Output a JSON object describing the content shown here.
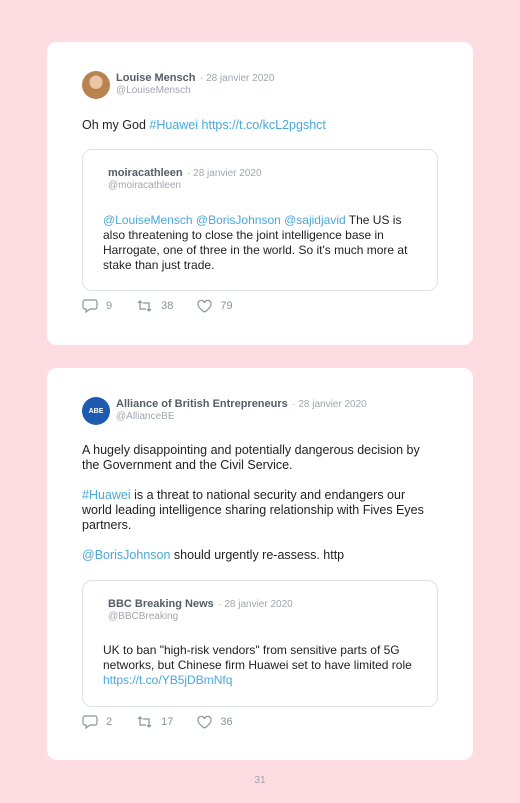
{
  "tweets": [
    {
      "author": "Louise Mensch",
      "date": "28 janvier 2020",
      "handle": "@LouiseMensch",
      "text_plain": "Oh my God ",
      "hashtag": "#Huawei",
      "link": "https://t.co/kcL2pgshct",
      "quote": {
        "author": "moiracathleen",
        "date": "28 janvier 2020",
        "handle": "@moiracathleen",
        "mentions": "@LouiseMensch @BorisJohnson @sajidjavid",
        "text": " The US is also threatening to close the joint intelligence base in Harrogate, one of three in the world. So it's much more at stake than just trade."
      },
      "replies": "9",
      "retweets": "38",
      "likes": "79"
    },
    {
      "author": "Alliance of British Entrepreneurs",
      "date": "28 janvier 2020",
      "handle": "@AllianceBE",
      "avatar_text": "ABE",
      "para1": "A hugely disappointing and potentially dangerous decision by the Government and the Civil Service.",
      "hashtag": "#Huawei",
      "para2": " is a threat to national security and endangers our world leading intelligence sharing relationship with Fives Eyes partners.",
      "mention": "@BorisJohnson",
      "para3": " should urgently re-assess. http",
      "quote": {
        "author": "BBC Breaking News",
        "date": "28 janvier 2020",
        "handle": "@BBCBreaking",
        "text": "UK to ban \"high-risk vendors\" from sensitive parts of 5G networks, but Chinese firm Huawei set to have limited role ",
        "link": "https://t.co/YB5jDBmNfq"
      },
      "replies": "2",
      "retweets": "17",
      "likes": "36"
    }
  ],
  "page_number": "31",
  "colors": {
    "background": "#fddde2",
    "link": "#4aa8d8",
    "card": "#ffffff"
  },
  "icons": [
    "reply-icon",
    "retweet-icon",
    "like-icon"
  ]
}
